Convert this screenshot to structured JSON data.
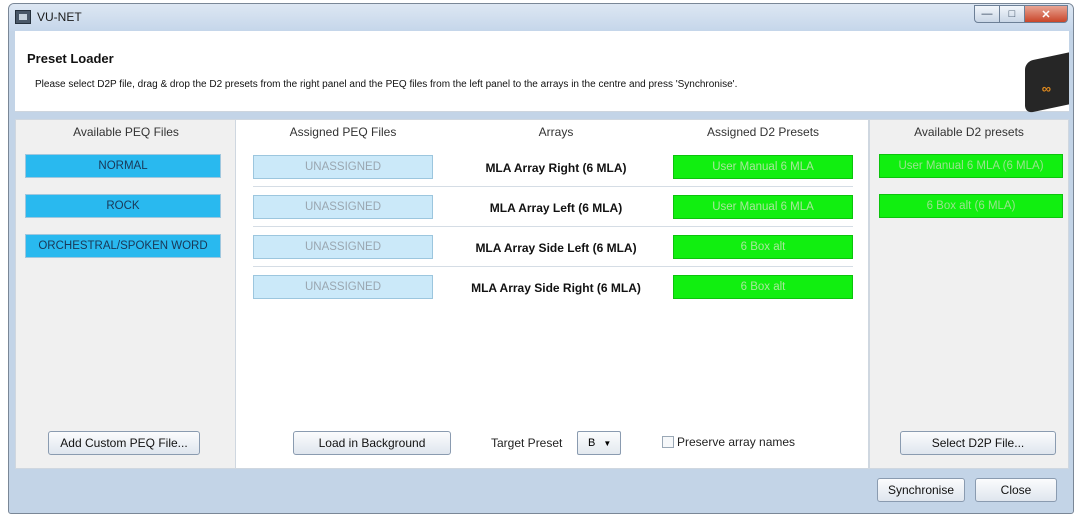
{
  "window": {
    "title": "VU-NET"
  },
  "header": {
    "title": "Preset Loader",
    "description": "Please select D2P file, drag & drop the D2 presets from the right panel and the PEQ files from the left panel to the arrays in the centre and press 'Synchronise'."
  },
  "left_panel": {
    "heading": "Available PEQ Files",
    "items": [
      "NORMAL",
      "ROCK",
      "ORCHESTRAL/SPOKEN WORD"
    ],
    "add_button": "Add Custom PEQ File..."
  },
  "center_panel": {
    "headings": {
      "assigned_peq": "Assigned PEQ Files",
      "arrays": "Arrays",
      "assigned_d2": "Assigned D2 Presets"
    },
    "rows": [
      {
        "peq": "UNASSIGNED",
        "array": "MLA Array Right (6 MLA)",
        "d2": "User Manual 6 MLA"
      },
      {
        "peq": "UNASSIGNED",
        "array": "MLA Array Left (6 MLA)",
        "d2": "User Manual 6 MLA"
      },
      {
        "peq": "UNASSIGNED",
        "array": "MLA Array Side Left (6 MLA)",
        "d2": "6 Box alt"
      },
      {
        "peq": "UNASSIGNED",
        "array": "MLA Array Side Right (6 MLA)",
        "d2": "6 Box alt"
      }
    ],
    "load_button": "Load in Background",
    "target_label": "Target Preset",
    "target_value": "B",
    "preserve_label": "Preserve array names",
    "preserve_checked": false
  },
  "right_panel": {
    "heading": "Available D2 presets",
    "items": [
      "User Manual 6 MLA (6 MLA)",
      "6 Box alt (6 MLA)"
    ],
    "select_button": "Select D2P File..."
  },
  "footer": {
    "synchronise_button": "Synchronise",
    "close_button": "Close"
  },
  "colors": {
    "peq_blue": "#29b9ef",
    "d2_green": "#11ef10",
    "unassigned_bg": "#cbe9f9",
    "window_bg": "#c3d4e7"
  },
  "icons": {
    "app": "vu-net-app-icon",
    "minimize": "minimize-icon",
    "maximize": "maximize-icon",
    "close": "close-icon",
    "logo": "l-acoustics-logo",
    "dropdown": "chevron-down-icon"
  }
}
